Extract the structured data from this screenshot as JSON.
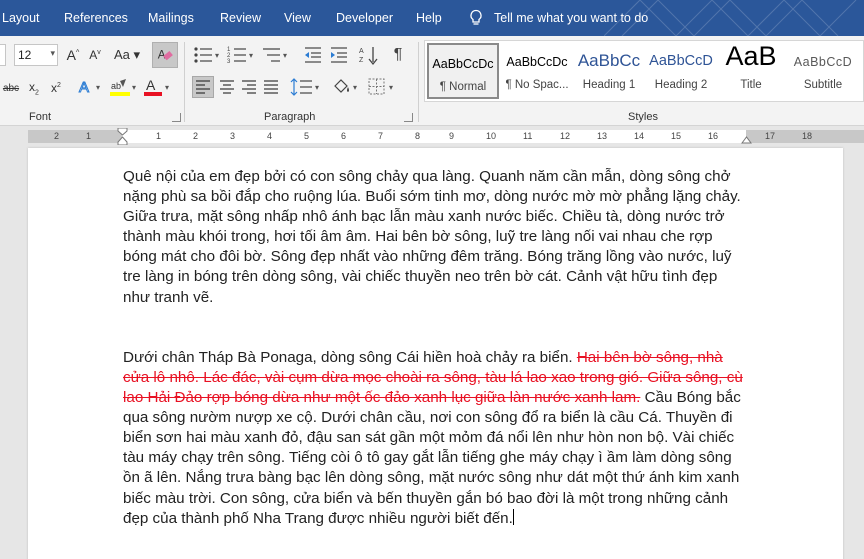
{
  "menu": {
    "tabs": [
      "Layout",
      "References",
      "Mailings",
      "Review",
      "View",
      "Developer",
      "Help"
    ],
    "tell_me": "Tell me what you want to do"
  },
  "ribbon": {
    "font_size": "12",
    "font_group_label": "Font",
    "paragraph_group_label": "Paragraph",
    "styles_group_label": "Styles",
    "styles": [
      {
        "preview": "AaBbCcDc",
        "name": "¶ Normal",
        "selected": true
      },
      {
        "preview": "AaBbCcDc",
        "name": "¶ No Spac...",
        "selected": false
      },
      {
        "preview": "AaBbCc",
        "name": "Heading 1",
        "selected": false
      },
      {
        "preview": "AaBbCcD",
        "name": "Heading 2",
        "selected": false
      },
      {
        "preview": "AaB",
        "name": "Title",
        "selected": false
      },
      {
        "preview": "AaBbCcD",
        "name": "Subtitle",
        "selected": false
      }
    ],
    "colors": {
      "highlight": "#ffff00",
      "font_color": "#e81123",
      "accent": "#2b579a"
    }
  },
  "ruler": {
    "numbers": [
      "2",
      "1",
      "1",
      "2",
      "3",
      "4",
      "5",
      "6",
      "7",
      "8",
      "9",
      "10",
      "11",
      "12",
      "13",
      "14",
      "15",
      "16",
      "17",
      "18"
    ]
  },
  "document": {
    "para1": "Quê nội của em đẹp bởi có con sông chảy qua làng. Quanh năm cần mẫn, dòng sông chở nặng phù sa bồi đắp cho ruộng lúa. Buổi sớm tinh mơ, dòng nước mờ mờ phẳng lặng chảy. Giữa trưa, mặt sông nhấp nhô ánh bạc lẫn màu xanh nước biếc. Chiều tà, dòng nước trở thành màu khói trong, hơi tối âm âm. Hai bên bờ sông, luỹ tre làng nối vai nhau che rợp bóng mát cho đôi bờ. Sông đẹp nhất vào những đêm trăng. Bóng trăng lồng vào nước, luỹ tre làng in bóng trên dòng sông, vài chiếc thuyền neo trên bờ cát. Cảnh vật hữu tình đẹp như tranh vẽ.",
    "para2_start": "Dưới chân Tháp Bà Ponaga, dòng sông Cái hiền hoà chảy ra biển. ",
    "para2_deleted": "Hai bên bờ sông, nhà cửa lô nhô. Lác đác, vài cụm dừa mọc choài ra sông, tàu lá lao xao trong gió. Giữa sông, cù lao Hải Đảo rợp bóng dừa như một ốc đảo xanh lục giữa làn nước xanh lam.",
    "para2_end": " Cầu Bóng bắc qua sông nườm nượp xe cộ. Dưới chân cầu, nơi con sông đổ ra biển là cầu Cá. Thuyền đi biển sơn hai màu xanh đỏ, đậu san sát gần một mỏm đá nổi lên như hòn non bộ. Vài chiếc tàu máy chạy trên sông. Tiếng còi ô tô gay gắt lẫn tiếng ghe máy chạy ì ầm làm dòng sông ồn ã lên. Nắng trưa bàng bạc lên dòng sông, mặt nước sông như dát một thứ ánh kim xanh biếc màu trời. Con sông, cửa biển và bến thuyền gắn bó bao đời là một trong những cảnh đẹp của thành phố Nha Trang được nhiều người biết đến."
  }
}
